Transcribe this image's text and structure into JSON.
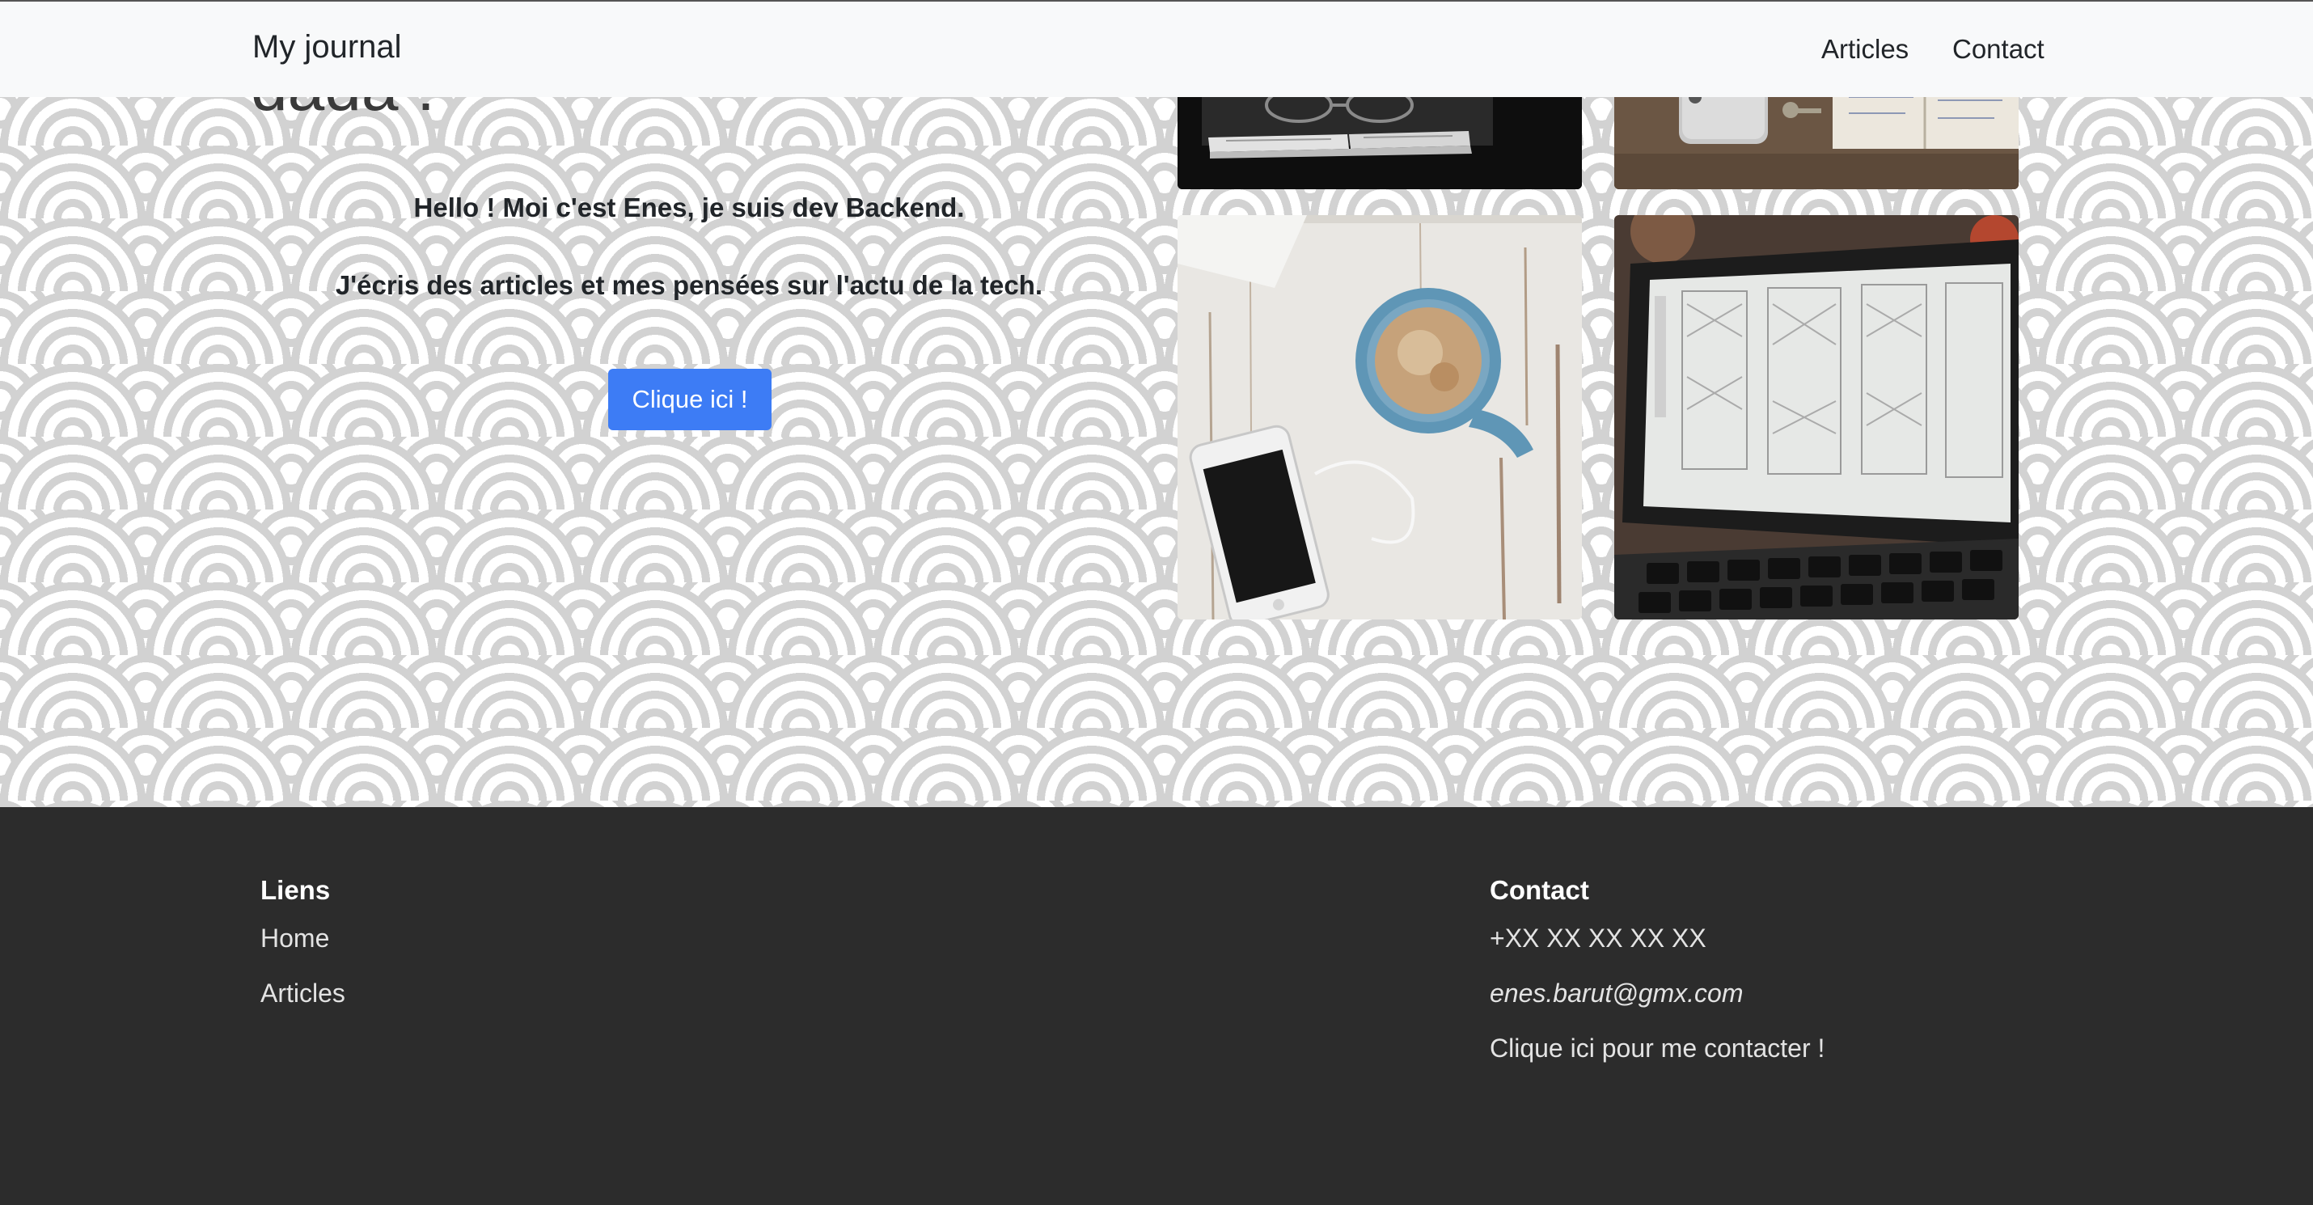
{
  "navbar": {
    "brand": "My journal",
    "links": [
      "Articles",
      "Contact"
    ]
  },
  "hero": {
    "title_partial": "dada !",
    "line1": "Hello ! Moi c'est Enes, je suis dev Backend.",
    "line2": "J'écris des articles et mes pensées sur l'actu de la tech.",
    "button": "Clique ici !"
  },
  "footer": {
    "links": {
      "heading": "Liens",
      "items": [
        "Home",
        "Articles"
      ]
    },
    "contact": {
      "heading": "Contact",
      "phone": "+XX XX XX XX XX",
      "email": "enes.barut@gmx.com",
      "cta": "Clique ici pour me contacter !"
    }
  },
  "colors": {
    "navbar_bg": "#f8f9fa",
    "button_bg": "#3d7cf5",
    "footer_bg": "#2c2c2c",
    "pattern": "#d2d2d2"
  }
}
